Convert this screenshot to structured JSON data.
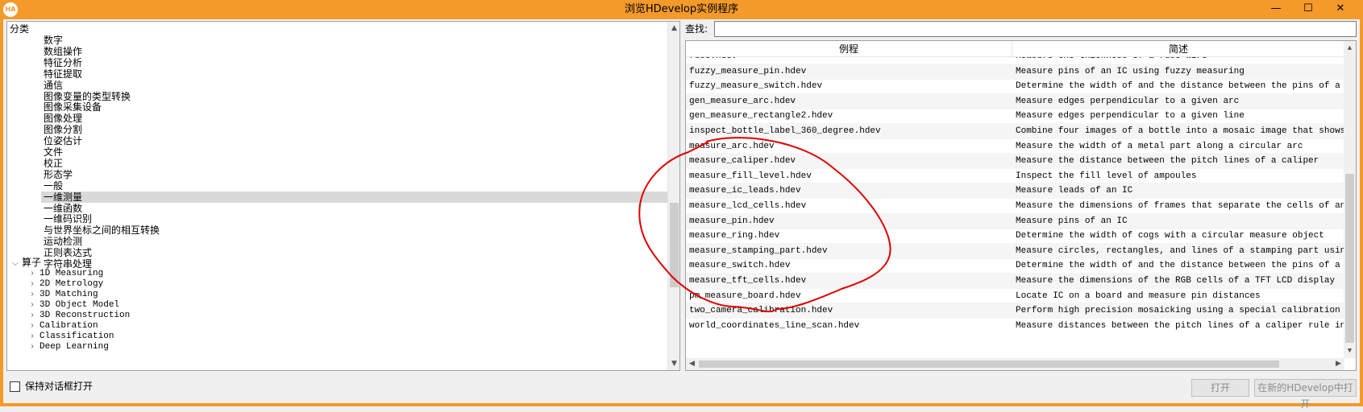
{
  "window": {
    "title": "浏览HDevelop实例程序",
    "app_icon_text": "HA",
    "minimize": "—",
    "maximize": "☐",
    "close": "✕",
    "accent": "#f39a2b"
  },
  "tree": {
    "root_label": "分类",
    "categories": [
      "数字",
      "数组操作",
      "特征分析",
      "特征提取",
      "通信",
      "图像变量的类型转换",
      "图像采集设备",
      "图像处理",
      "图像分割",
      "位姿估计",
      "文件",
      "校正",
      "形态学",
      "一般",
      "一维测量",
      "一维函数",
      "一维码识别",
      "与世界坐标之间的相互转换",
      "运动检测",
      "正则表达式",
      "字符串处理"
    ],
    "selected_index": 14,
    "operators_label": "算子",
    "operators": [
      "1D Measuring",
      "2D Metrology",
      "3D Matching",
      "3D Object Model",
      "3D Reconstruction",
      "Calibration",
      "Classification",
      "Deep Learning"
    ]
  },
  "search": {
    "label": "查找:",
    "value": ""
  },
  "table": {
    "col1": "例程",
    "col2": "简述",
    "rows": [
      [
        "fuse.hdev",
        "Measure the thickness of a fuse wire"
      ],
      [
        "fuzzy_measure_pin.hdev",
        "Measure pins of an IC using fuzzy measuring"
      ],
      [
        "fuzzy_measure_switch.hdev",
        "Determine the width of and the distance between the pins of a switch"
      ],
      [
        "gen_measure_arc.hdev",
        "Measure edges perpendicular to a given arc"
      ],
      [
        "gen_measure_rectangle2.hdev",
        "Measure edges perpendicular to a given line"
      ],
      [
        "inspect_bottle_label_360_degree.hdev",
        "Combine four images of a bottle into a mosaic image that shows the un"
      ],
      [
        "measure_arc.hdev",
        "Measure the width of a metal part along a circular arc"
      ],
      [
        "measure_caliper.hdev",
        "Measure the distance between the pitch lines of a caliper"
      ],
      [
        "measure_fill_level.hdev",
        "Inspect the fill level of ampoules"
      ],
      [
        "measure_ic_leads.hdev",
        "Measure leads of an IC"
      ],
      [
        "measure_lcd_cells.hdev",
        "Measure the dimensions of frames that separate the cells of an LCD di"
      ],
      [
        "measure_pin.hdev",
        "Measure pins of an IC"
      ],
      [
        "measure_ring.hdev",
        "Determine the width of cogs with a circular measure object"
      ],
      [
        "measure_stamping_part.hdev",
        "Measure circles, rectangles, and lines of a stamping part using an al"
      ],
      [
        "measure_switch.hdev",
        "Determine the width of and the distance between the pins of a switch"
      ],
      [
        "measure_tft_cells.hdev",
        "Measure the dimensions of the RGB cells of a TFT LCD display"
      ],
      [
        "pm_measure_board.hdev",
        "Locate IC on a board and measure pin distances"
      ],
      [
        "two_camera_calibration.hdev",
        "Perform high precision mosaicking using a special calibration object"
      ],
      [
        "world_coordinates_line_scan.hdev",
        "Measure distances between the pitch lines of a caliper rule in a line"
      ]
    ]
  },
  "footer": {
    "keep_open_label": "保持对话框打开",
    "open_button": "打开",
    "open_new_button": "在新的HDevelop中打开"
  },
  "annotation_color": "#e00000"
}
